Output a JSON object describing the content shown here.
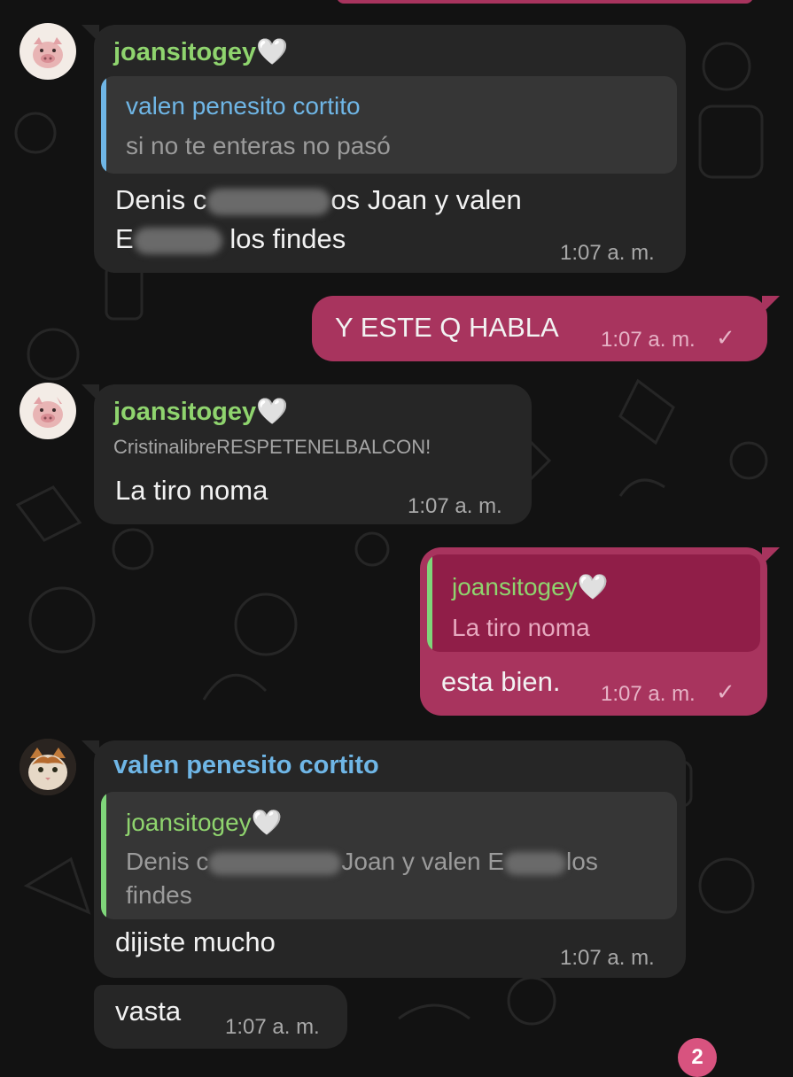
{
  "messages": [
    {
      "sender": "joansitogey",
      "sender_emoji": "🤍",
      "quote": {
        "name": "valen penesito cortito",
        "text": "si no te enteras no pasó"
      },
      "body_line1_a": "Denis c",
      "body_line1_b": "os Joan y valen",
      "body_line2_a": "E",
      "body_line2_b": "los findes",
      "time": "1:07 a. m."
    },
    {
      "body": "Y ESTE Q HABLA",
      "time": "1:07 a. m.",
      "status": "✓"
    },
    {
      "sender": "joansitogey",
      "sender_emoji": "🤍",
      "subtitle": "CristinalibreRESPETENELBALCON!",
      "body": "La tiro noma",
      "time": "1:07 a. m."
    },
    {
      "quote": {
        "name": "joansitogey",
        "name_emoji": "🤍",
        "text": "La tiro noma"
      },
      "body": "esta bien.",
      "time": "1:07 a. m.",
      "status": "✓"
    },
    {
      "sender": "valen penesito cortito",
      "quote": {
        "name": "joansitogey",
        "name_emoji": "🤍",
        "text_a": "Denis c",
        "text_b": "Joan y valen E",
        "text_c": "los",
        "text_line2": "findes"
      },
      "body": "dijiste mucho",
      "time": "1:07 a. m."
    },
    {
      "body": "vasta",
      "time": "1:07 a. m."
    }
  ],
  "unread_badge": "2",
  "colors": {
    "background": "#121212",
    "incoming_bubble": "#262626",
    "outgoing_bubble": "#a8345e",
    "green_name": "#8fd46e",
    "blue_name": "#6fb6e6"
  }
}
